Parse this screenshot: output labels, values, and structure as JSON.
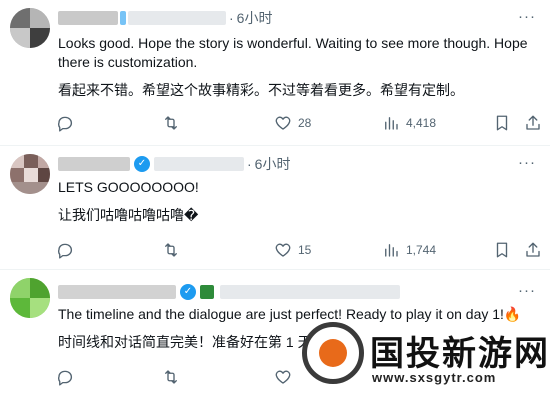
{
  "tweets": [
    {
      "time": "6小时",
      "body_en": "Looks good. Hope the story is wonderful. Waiting to see more though. Hope there is customization.",
      "body_zh": "看起来不错。希望这个故事精彩。不过等着看更多。希望有定制。",
      "likes": "28",
      "views": "4,418",
      "verified": false
    },
    {
      "time": "6小时",
      "body_en": "LETS GOOOOOOOO!",
      "body_zh": "让我们咕噜咕噜咕噜�",
      "likes": "15",
      "views": "1,744",
      "verified": true
    },
    {
      "time": "",
      "body_en": "The timeline and the dialogue are just perfect! Ready to play it on day 1!🔥",
      "body_zh": "时间线和对话简直完美！准备好在第 1 天",
      "verified": true
    }
  ],
  "watermark": {
    "name": "国投新游网",
    "url": "www.sxsgytr.com"
  },
  "colors": {
    "accent": "#1d9bf0",
    "text": "#0f1419",
    "muted": "#536471",
    "divider": "#eff3f4"
  },
  "icons": [
    "more-icon",
    "reply-icon",
    "retweet-icon",
    "like-icon",
    "views-icon",
    "bookmark-icon",
    "share-icon",
    "verified-icon"
  ]
}
